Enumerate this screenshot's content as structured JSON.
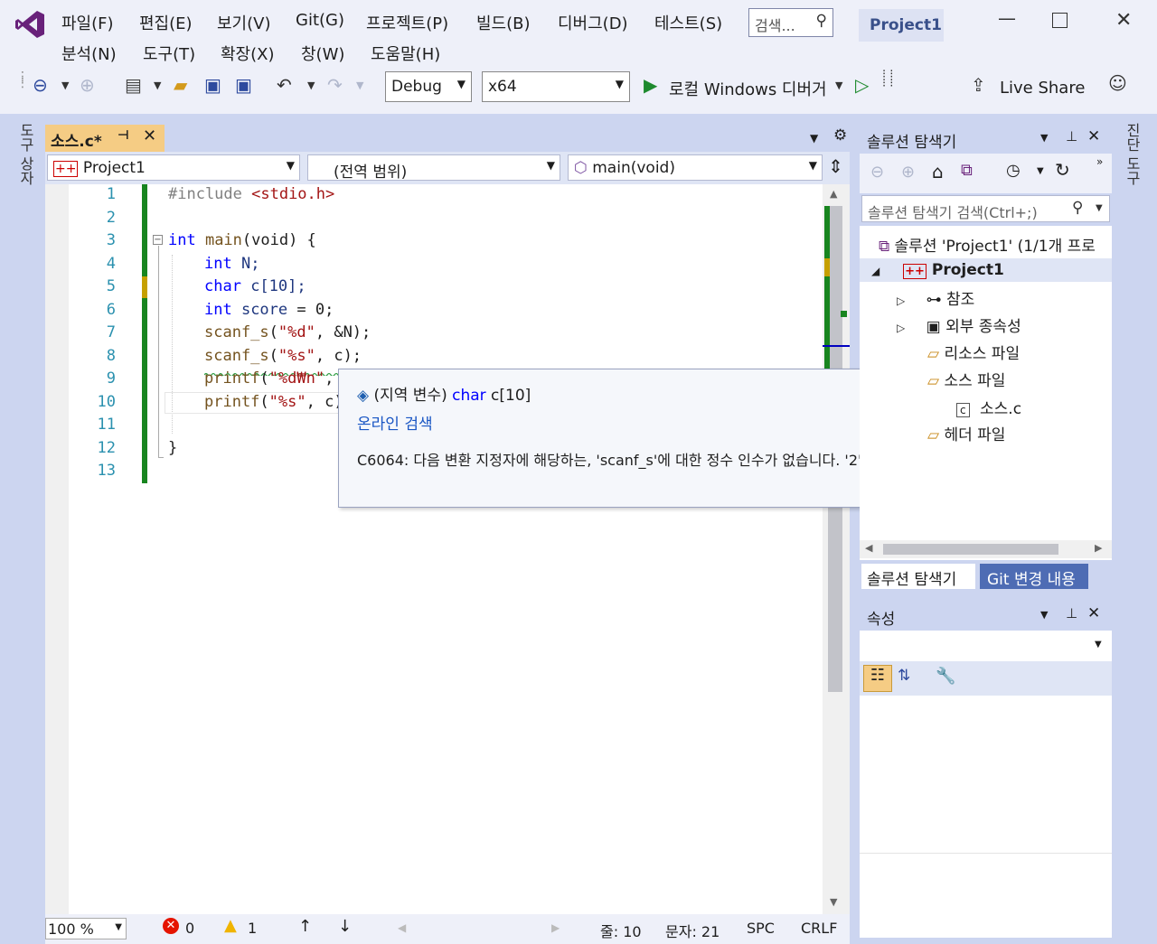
{
  "menu": {
    "row1": [
      "파일(F)",
      "편집(E)",
      "보기(V)",
      "Git(G)",
      "프로젝트(P)",
      "빌드(B)",
      "디버그(D)",
      "테스트(S)"
    ],
    "row2": [
      "분석(N)",
      "도구(T)",
      "확장(X)",
      "창(W)",
      "도움말(H)"
    ]
  },
  "search": {
    "placeholder": "검색..."
  },
  "project_badge": "Project1",
  "toolbar": {
    "config": "Debug",
    "platform": "x64",
    "run_label": "로컬 Windows 디버거",
    "live_share": "Live Share"
  },
  "left_strip": "도구 상자",
  "right_strip": "진단 도구",
  "editor": {
    "tab_label": "소스.c*",
    "nav_project": "Project1",
    "nav_scope": "(전역 범위)",
    "nav_function": "main(void)",
    "line_numbers": [
      "1",
      "2",
      "3",
      "4",
      "5",
      "6",
      "7",
      "8",
      "9",
      "10",
      "11",
      "12",
      "13"
    ]
  },
  "code": {
    "l1_pp": "#include ",
    "l1_hdr": "<stdio.h>",
    "l3_kw": "int",
    "l3_fn": " main",
    "l3_rest": "(void) {",
    "l4_kw": "int",
    "l4_rest": " N;",
    "l5_kw": "char",
    "l5_rest": " c[10];",
    "l6_kw": "int",
    "l6_var": " score",
    "l6_rest": " = 0;",
    "l7_fn": "scanf_s",
    "l7_p1": "(",
    "l7_str": "\"%d\"",
    "l7_rest": ", &N);",
    "l8_fn": "scanf_s",
    "l8_p1": "(",
    "l8_str": "\"%s\"",
    "l8_rest": ", c);",
    "l9_fn": "printf",
    "l9_p1": "(",
    "l9_str": "\"%d₩n\"",
    "l9_rest": ",",
    "l10_fn": "printf",
    "l10_p1": "(",
    "l10_str": "\"%s\"",
    "l10_rest": ", c)",
    "l12": "}"
  },
  "tooltip": {
    "signature_prefix": "(지역 변수) ",
    "signature_type": "char",
    "signature_rest": " c[10]",
    "online_search": "온라인 검색",
    "message": "C6064: 다음 변환 지정자에 해당하는, 'scanf_s'에 대한 정수 인수가 없습니다. '2'"
  },
  "status": {
    "zoom": "100 %",
    "errors": "0",
    "warnings": "1",
    "line": "줄: 10",
    "col": "문자: 21",
    "spc": "SPC",
    "crlf": "CRLF"
  },
  "solution_explorer": {
    "title": "솔루션 탐색기",
    "search_placeholder": "솔루션 탐색기 검색(Ctrl+;)",
    "solution_node": "솔루션 'Project1' (1/1개 프로",
    "project_node": "Project1",
    "items": [
      "참조",
      "외부 종속성",
      "리소스 파일",
      "소스 파일",
      "소스.c",
      "헤더 파일"
    ],
    "tab_solution": "솔루션 탐색기",
    "tab_git": "Git 변경 내용"
  },
  "properties": {
    "title": "속성"
  },
  "colors": {
    "accent": "#68217a",
    "active_tab": "#f5cc84",
    "change_bar_green": "#18851f",
    "change_bar_yellow": "#c6a000",
    "error_red": "#e51400",
    "warning_yellow": "#f0b400"
  }
}
